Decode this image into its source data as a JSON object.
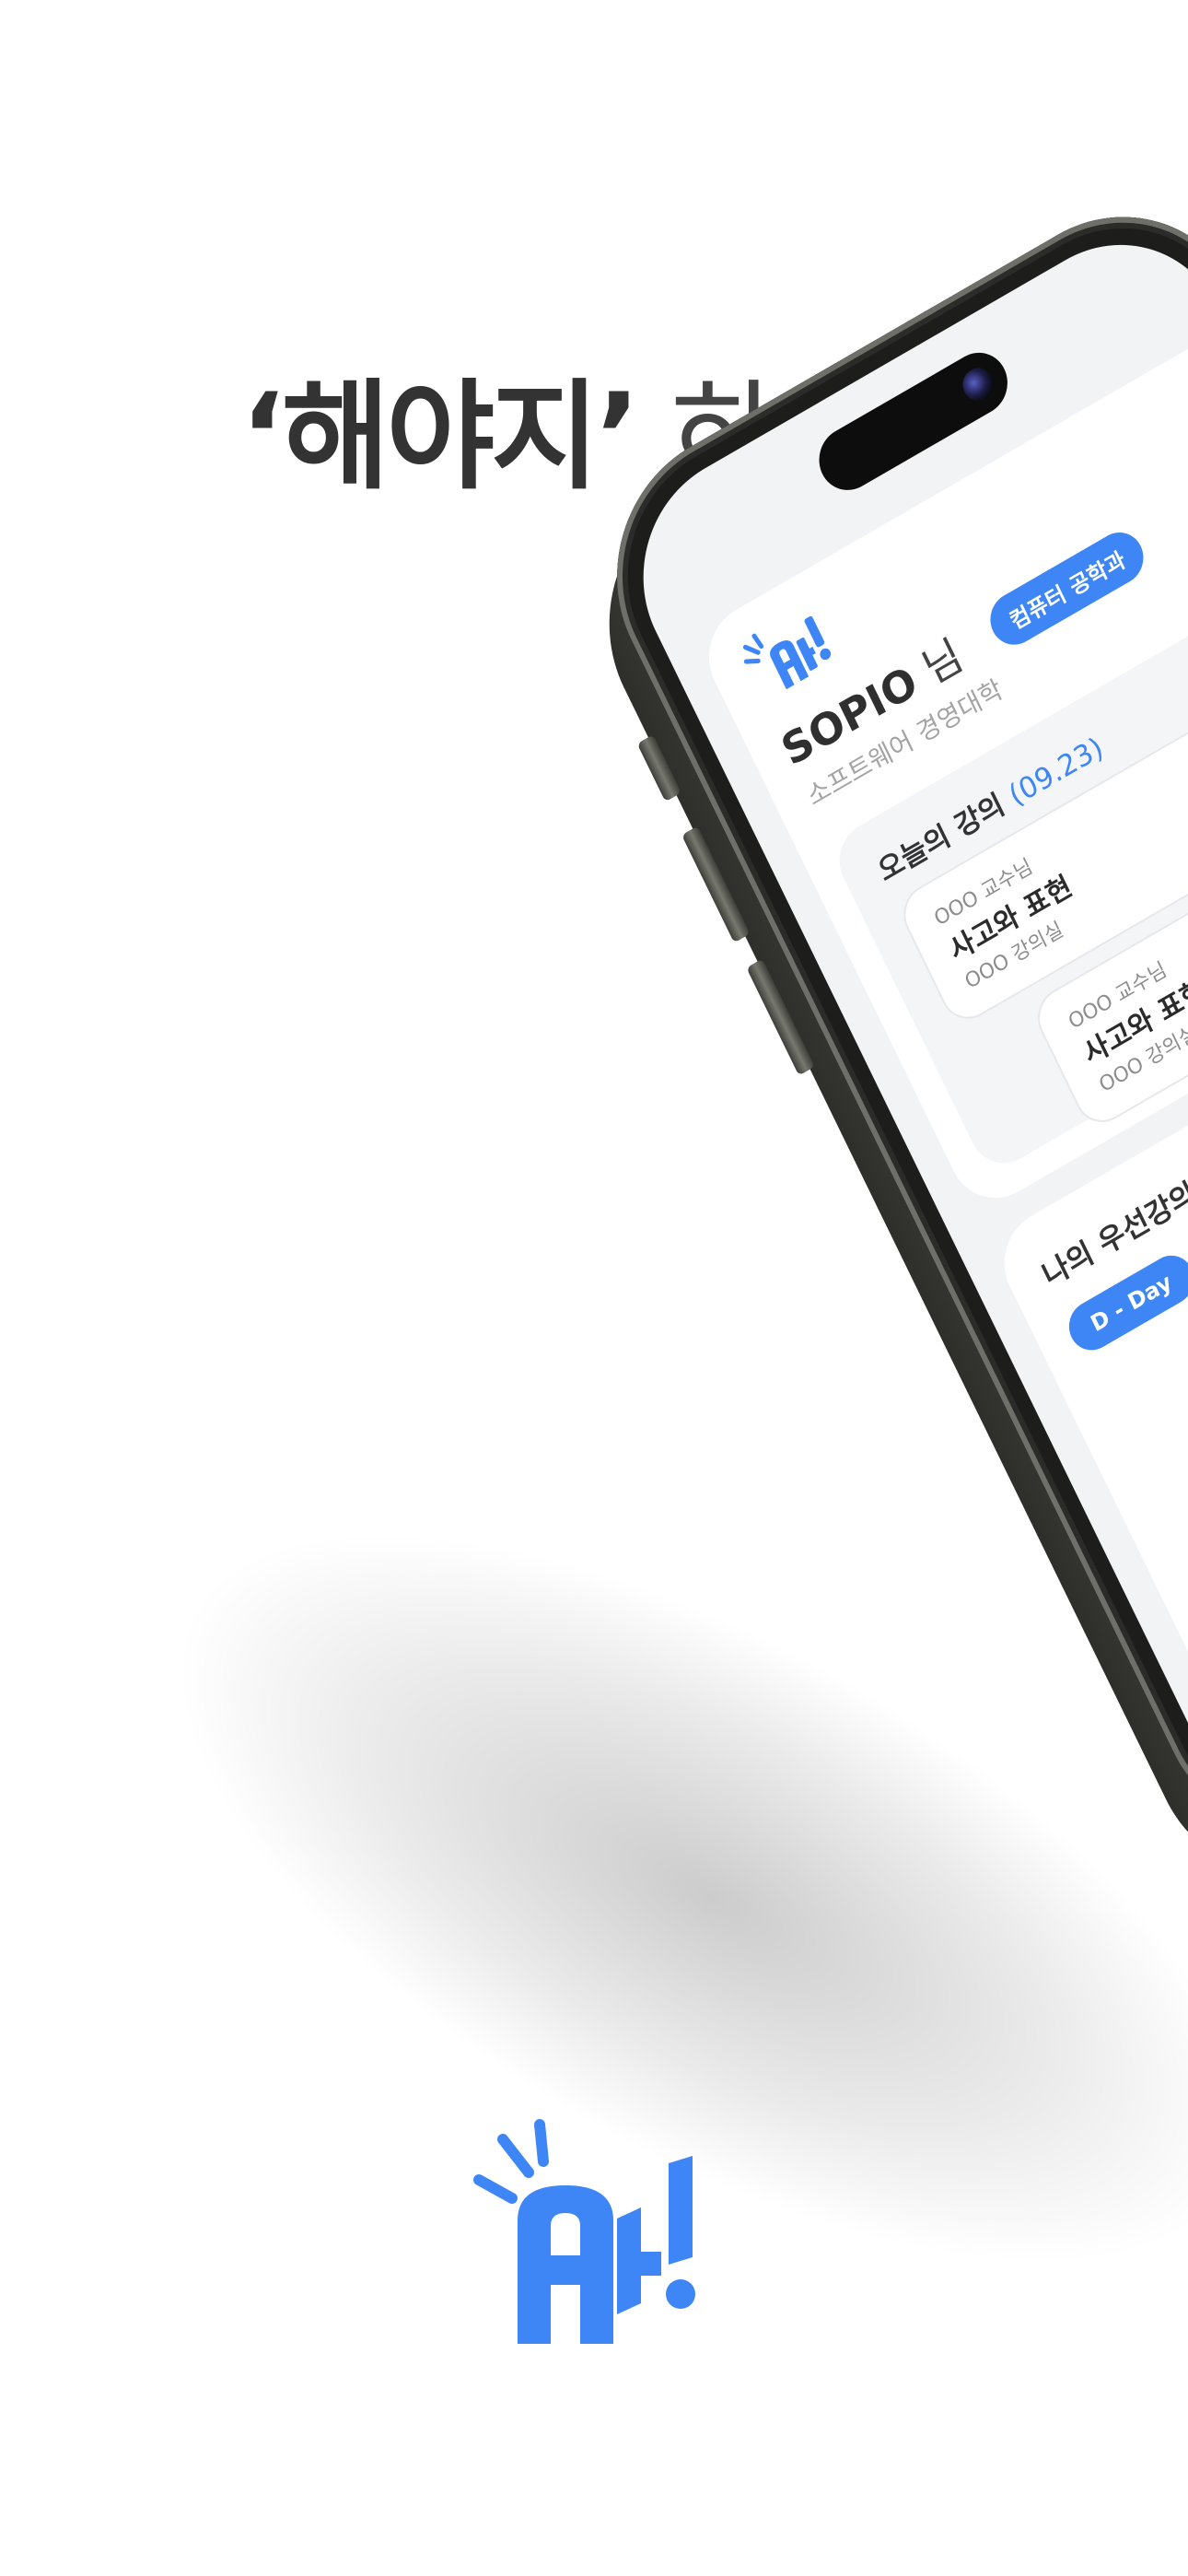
{
  "headline": {
    "bold": "‘해야지’",
    "light": " 하고 ,"
  },
  "app": {
    "user_name": "SOPIO",
    "user_suffix": " 님",
    "school": "소프트웨어 경영대학",
    "department": "컴퓨터 공학과",
    "today_title": "오늘의 강의",
    "today_date": "(09.23)",
    "lectures": [
      {
        "professor": "OOO 교수님",
        "name": "사고와 표현",
        "room": "OOO 강의실"
      },
      {
        "professor": "OOO 교수님",
        "name": "사고와 표현",
        "room": "OOO 강의실"
      }
    ],
    "priority_title": "나의 우선강의",
    "dday_label": "D - Day"
  },
  "colors": {
    "accent": "#3e86f5",
    "headline": "#333333",
    "phone_frame": "#1d1d1b"
  }
}
